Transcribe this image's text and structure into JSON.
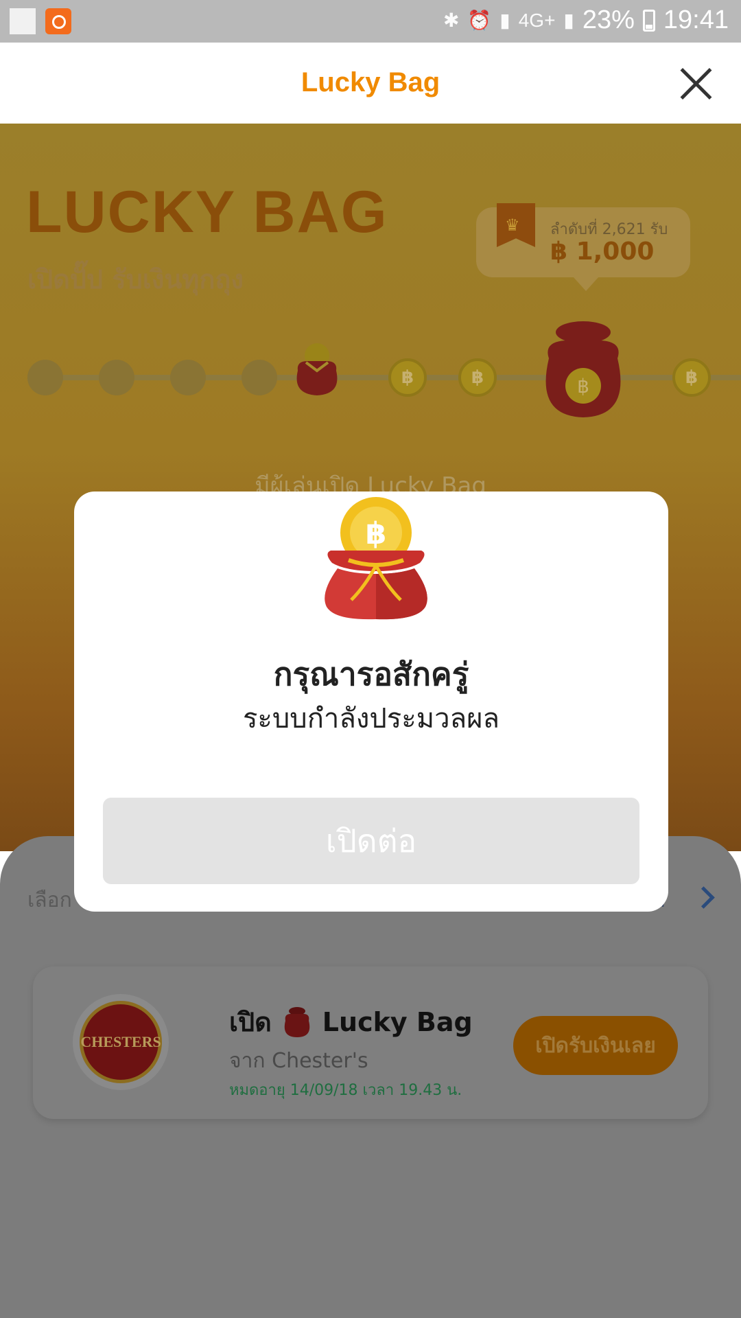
{
  "status_bar": {
    "battery": "23%",
    "time": "19:41",
    "network": "4G+"
  },
  "app_bar": {
    "title": "Lucky Bag"
  },
  "game": {
    "title": "LUCKY BAG",
    "subtitle": "เปิดปั๊ป รับเงินทุกถุง",
    "rank_label": "ลำดับที่ 2,621 รับ",
    "rank_amount": "฿ 1,000",
    "hint": "มีผู้เล่นเปิด Lucky Bag",
    "coin_symbol": "฿"
  },
  "panel": {
    "left_label": "เลือก",
    "right_label": "ติ",
    "card": {
      "logo_text": "CHESTERS",
      "title_prefix": "เปิด",
      "title_suffix": "Lucky Bag",
      "from": "จาก Chester's",
      "expiry": "หมดอายุ 14/09/18 เวลา 19.43 น.",
      "button": "เปิดรับเงินเลย"
    }
  },
  "modal": {
    "title": "กรุณารอสักครู่",
    "subtitle": "ระบบกำลังประมวลผล",
    "button": "เปิดต่อ"
  },
  "colors": {
    "accent": "#f08a00",
    "bag_red": "#c9302c",
    "coin_gold": "#f2c01e"
  }
}
